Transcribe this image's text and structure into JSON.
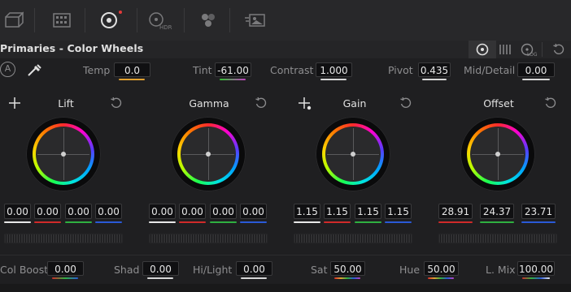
{
  "toolbar": {
    "icons": [
      {
        "name": "camera-raw-icon"
      },
      {
        "name": "color-match-icon"
      },
      {
        "name": "color-wheels-icon"
      },
      {
        "name": "hdr-wheels-icon",
        "sub": "HDR"
      },
      {
        "name": "rgb-mixer-icon"
      },
      {
        "name": "motion-effects-icon"
      }
    ]
  },
  "panel": {
    "title": "Primaries - Color Wheels",
    "log_label": "LOG"
  },
  "params_top": [
    {
      "label": "Temp",
      "value": "0.0",
      "bar_color": "#e0a030"
    },
    {
      "label": "Tint",
      "value": "-61.00",
      "bar_color": "#c040c0"
    },
    {
      "label": "Contrast",
      "value": "1.000",
      "bar_color": "#d8d8d8"
    },
    {
      "label": "Pivot",
      "value": "0.435",
      "bar_color": "#d8d8d8"
    },
    {
      "label": "Mid/Detail",
      "value": "0.00",
      "bar_color": "#d8d8d8"
    }
  ],
  "auto_badge": "A",
  "wheels": [
    {
      "title": "Lift",
      "values": [
        "0.00",
        "0.00",
        "0.00",
        "0.00"
      ],
      "has_picker": true
    },
    {
      "title": "Gamma",
      "values": [
        "0.00",
        "0.00",
        "0.00",
        "0.00"
      ],
      "has_picker": false
    },
    {
      "title": "Gain",
      "values": [
        "1.15",
        "1.15",
        "1.15",
        "1.15"
      ],
      "has_picker": true
    },
    {
      "title": "Offset",
      "values": [
        "28.91",
        "24.37",
        "23.71"
      ],
      "has_picker": false
    }
  ],
  "channel_colors": {
    "y": "#e8e8e8",
    "r": "#d02a2a",
    "g": "#2fb040",
    "b": "#2a5ad8"
  },
  "params_bottom": [
    {
      "label": "Col Boost",
      "value": "0.00"
    },
    {
      "label": "Shad",
      "value": "0.00"
    },
    {
      "label": "Hi/Light",
      "value": "0.00"
    },
    {
      "label": "Sat",
      "value": "50.00"
    },
    {
      "label": "Hue",
      "value": "50.00"
    },
    {
      "label": "L. Mix",
      "value": "100.00"
    }
  ]
}
